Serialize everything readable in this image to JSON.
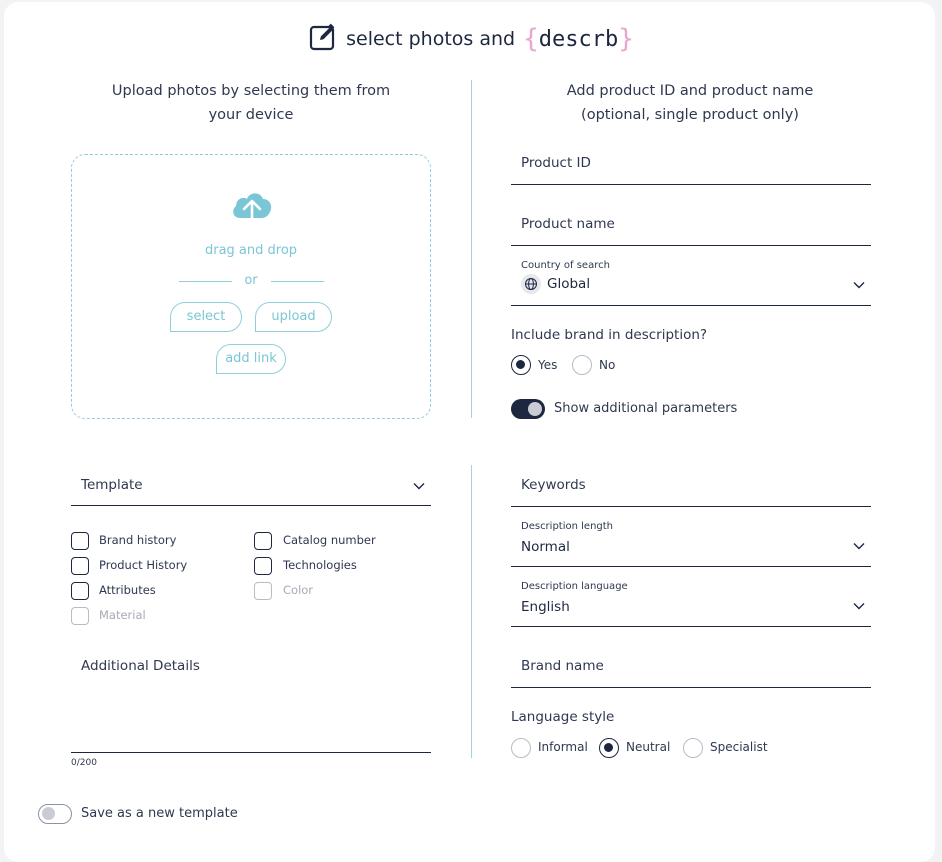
{
  "header": {
    "title": "select photos and",
    "brand_open": "{",
    "brand_name": "descrb",
    "brand_close": "}",
    "brand_accent_color": "#e9a6cf",
    "icon": "edit-icon"
  },
  "upload": {
    "heading": "Upload photos by selecting them from your device",
    "icon": "cloud-upload-icon",
    "drag_text": "drag and drop",
    "or_text": "or",
    "select_label": "select",
    "upload_label": "upload",
    "add_link_label": "add link"
  },
  "product": {
    "heading_line1": "Add product ID and product name",
    "heading_line2": "(optional, single product only)",
    "product_id_placeholder": "Product ID",
    "product_name_placeholder": "Product name",
    "country_label": "Country of search",
    "country_value": "Global",
    "brand_question": "Include brand in description?",
    "brand_options": [
      "Yes",
      "No"
    ],
    "brand_selected": "Yes",
    "show_params_label": "Show additional parameters",
    "show_params_on": true
  },
  "template": {
    "placeholder": "Template",
    "checkboxes": [
      {
        "label": "Brand history",
        "disabled": false
      },
      {
        "label": "Catalog number",
        "disabled": false
      },
      {
        "label": "Product History",
        "disabled": false
      },
      {
        "label": "Technologies",
        "disabled": false
      },
      {
        "label": "Attributes",
        "disabled": false
      },
      {
        "label": "Color",
        "disabled": true
      },
      {
        "label": "Material",
        "disabled": true
      }
    ],
    "additional_details_placeholder": "Additional Details",
    "counter": "0/200",
    "save_template_label": "Save as a new template",
    "save_template_on": false
  },
  "params": {
    "keywords_placeholder": "Keywords",
    "length_label": "Description length",
    "length_value": "Normal",
    "language_label": "Description language",
    "language_value": "English",
    "brand_name_placeholder": "Brand name",
    "style_label": "Language style",
    "style_options": [
      "Informal",
      "Neutral",
      "Specialist"
    ],
    "style_selected": "Neutral"
  },
  "colors": {
    "primary": "#1d2740",
    "accent": "#7ac6d6",
    "divider": "#9fd3e0"
  }
}
